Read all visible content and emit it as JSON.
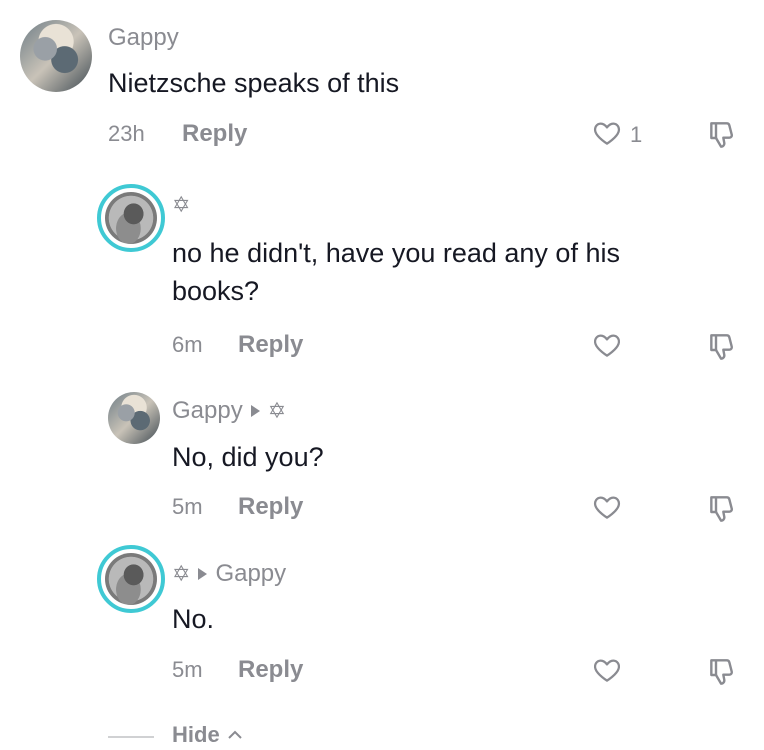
{
  "comments": [
    {
      "author": "Gappy",
      "text": "Nietzsche speaks of this",
      "time": "23h",
      "reply_label": "Reply",
      "likes": "1"
    },
    {
      "author_badge": "✡",
      "text": "no he didn't, have you read any of his books?",
      "time": "6m",
      "reply_label": "Reply"
    },
    {
      "author": "Gappy",
      "reply_to_badge": "✡",
      "text": "No, did you?",
      "time": "5m",
      "reply_label": "Reply"
    },
    {
      "author_badge": "✡",
      "reply_to": "Gappy",
      "text": "No.",
      "time": "5m",
      "reply_label": "Reply"
    }
  ],
  "hide_label": "Hide",
  "icons": {
    "like": "heart-outline-icon",
    "dislike": "thumbs-down-icon",
    "collapse": "chevron-up-icon"
  },
  "colors": {
    "ring": "#3fc9d4",
    "secondary_text": "#8a8b91",
    "primary_text": "#161823"
  }
}
